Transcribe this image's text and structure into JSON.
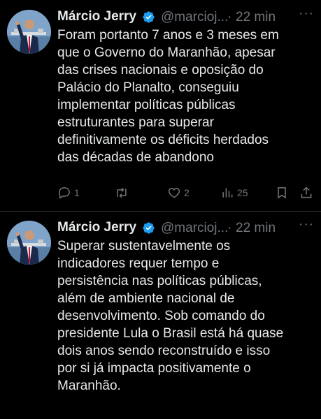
{
  "tweets": [
    {
      "author_name": "Márcio Jerry",
      "handle": "@marcioj...",
      "separator": "·",
      "time": "22 min",
      "text": "Foram portanto 7 anos e 3 meses em\nque o Governo do Maranhão, apesar\ndas crises nacionais e oposição do\nPalácio do Planalto, conseguiu\nimplementar políticas públicas\nestruturantes para superar\ndefinitivamente os déficits  herdados\ndas décadas de abandono",
      "replies": "1",
      "retweets": "",
      "likes": "2",
      "views": "25"
    },
    {
      "author_name": "Márcio Jerry",
      "handle": "@marcioj...",
      "separator": "·",
      "time": "22 min",
      "text": "Superar sustentavelmente os\nindicadores requer tempo e\npersistência nas políticas públicas,\nalém de ambiente nacional de\ndesenvolvimento. Sob comando do\npresidente Lula o Brasil está há quase\ndois anos sendo reconstruído e isso\npor si já impacta positivamente o\nMaranhão."
    }
  ],
  "icons": {
    "more": "more-horizontal-icon",
    "verified": "verified-badge-icon",
    "reply": "reply-icon",
    "retweet": "retweet-icon",
    "like": "heart-icon",
    "views": "views-bar-chart-icon",
    "bookmark": "bookmark-icon",
    "share": "share-icon"
  },
  "colors": {
    "background": "#000000",
    "text": "#e7e9ea",
    "secondary": "#71767b",
    "verified": "#1d9bf0"
  }
}
